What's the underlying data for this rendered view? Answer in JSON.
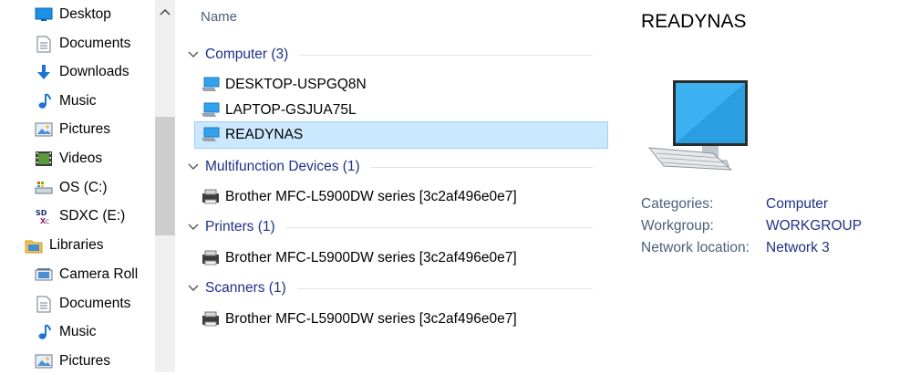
{
  "nav": {
    "items": [
      {
        "label": "Desktop",
        "icon": "desktop-icon"
      },
      {
        "label": "Documents",
        "icon": "documents-icon"
      },
      {
        "label": "Downloads",
        "icon": "downloads-icon"
      },
      {
        "label": "Music",
        "icon": "music-icon"
      },
      {
        "label": "Pictures",
        "icon": "pictures-icon"
      },
      {
        "label": "Videos",
        "icon": "videos-icon"
      },
      {
        "label": "OS (C:)",
        "icon": "os-drive-icon"
      },
      {
        "label": "SDXC (E:)",
        "icon": "sd-card-icon"
      },
      {
        "label": "Libraries",
        "icon": "libraries-icon"
      },
      {
        "label": "Camera Roll",
        "icon": "camera-roll-icon"
      },
      {
        "label": "Documents",
        "icon": "documents-icon"
      },
      {
        "label": "Music",
        "icon": "music-icon"
      },
      {
        "label": "Pictures",
        "icon": "pictures-icon"
      }
    ]
  },
  "list": {
    "column_name": "Name",
    "groups": [
      {
        "name": "Computer (3)",
        "items": [
          "DESKTOP-USPGQ8N",
          "LAPTOP-GSJUA75L",
          "READYNAS"
        ]
      },
      {
        "name": "Multifunction Devices (1)",
        "items": [
          "Brother MFC-L5900DW series [3c2af496e0e7]"
        ]
      },
      {
        "name": "Printers (1)",
        "items": [
          "Brother MFC-L5900DW series [3c2af496e0e7]"
        ]
      },
      {
        "name": "Scanners (1)",
        "items": [
          "Brother MFC-L5900DW series [3c2af496e0e7]"
        ]
      }
    ],
    "selected_item": "READYNAS"
  },
  "details": {
    "title": "READYNAS",
    "properties": [
      {
        "key": "Categories:",
        "value": "Computer"
      },
      {
        "key": "Workgroup:",
        "value": "WORKGROUP"
      },
      {
        "key": "Network location:",
        "value": "Network 3"
      }
    ]
  },
  "colors": {
    "selection_bg": "#cce8ff",
    "group_header": "#1e3287",
    "label_gray": "#4c607a"
  }
}
